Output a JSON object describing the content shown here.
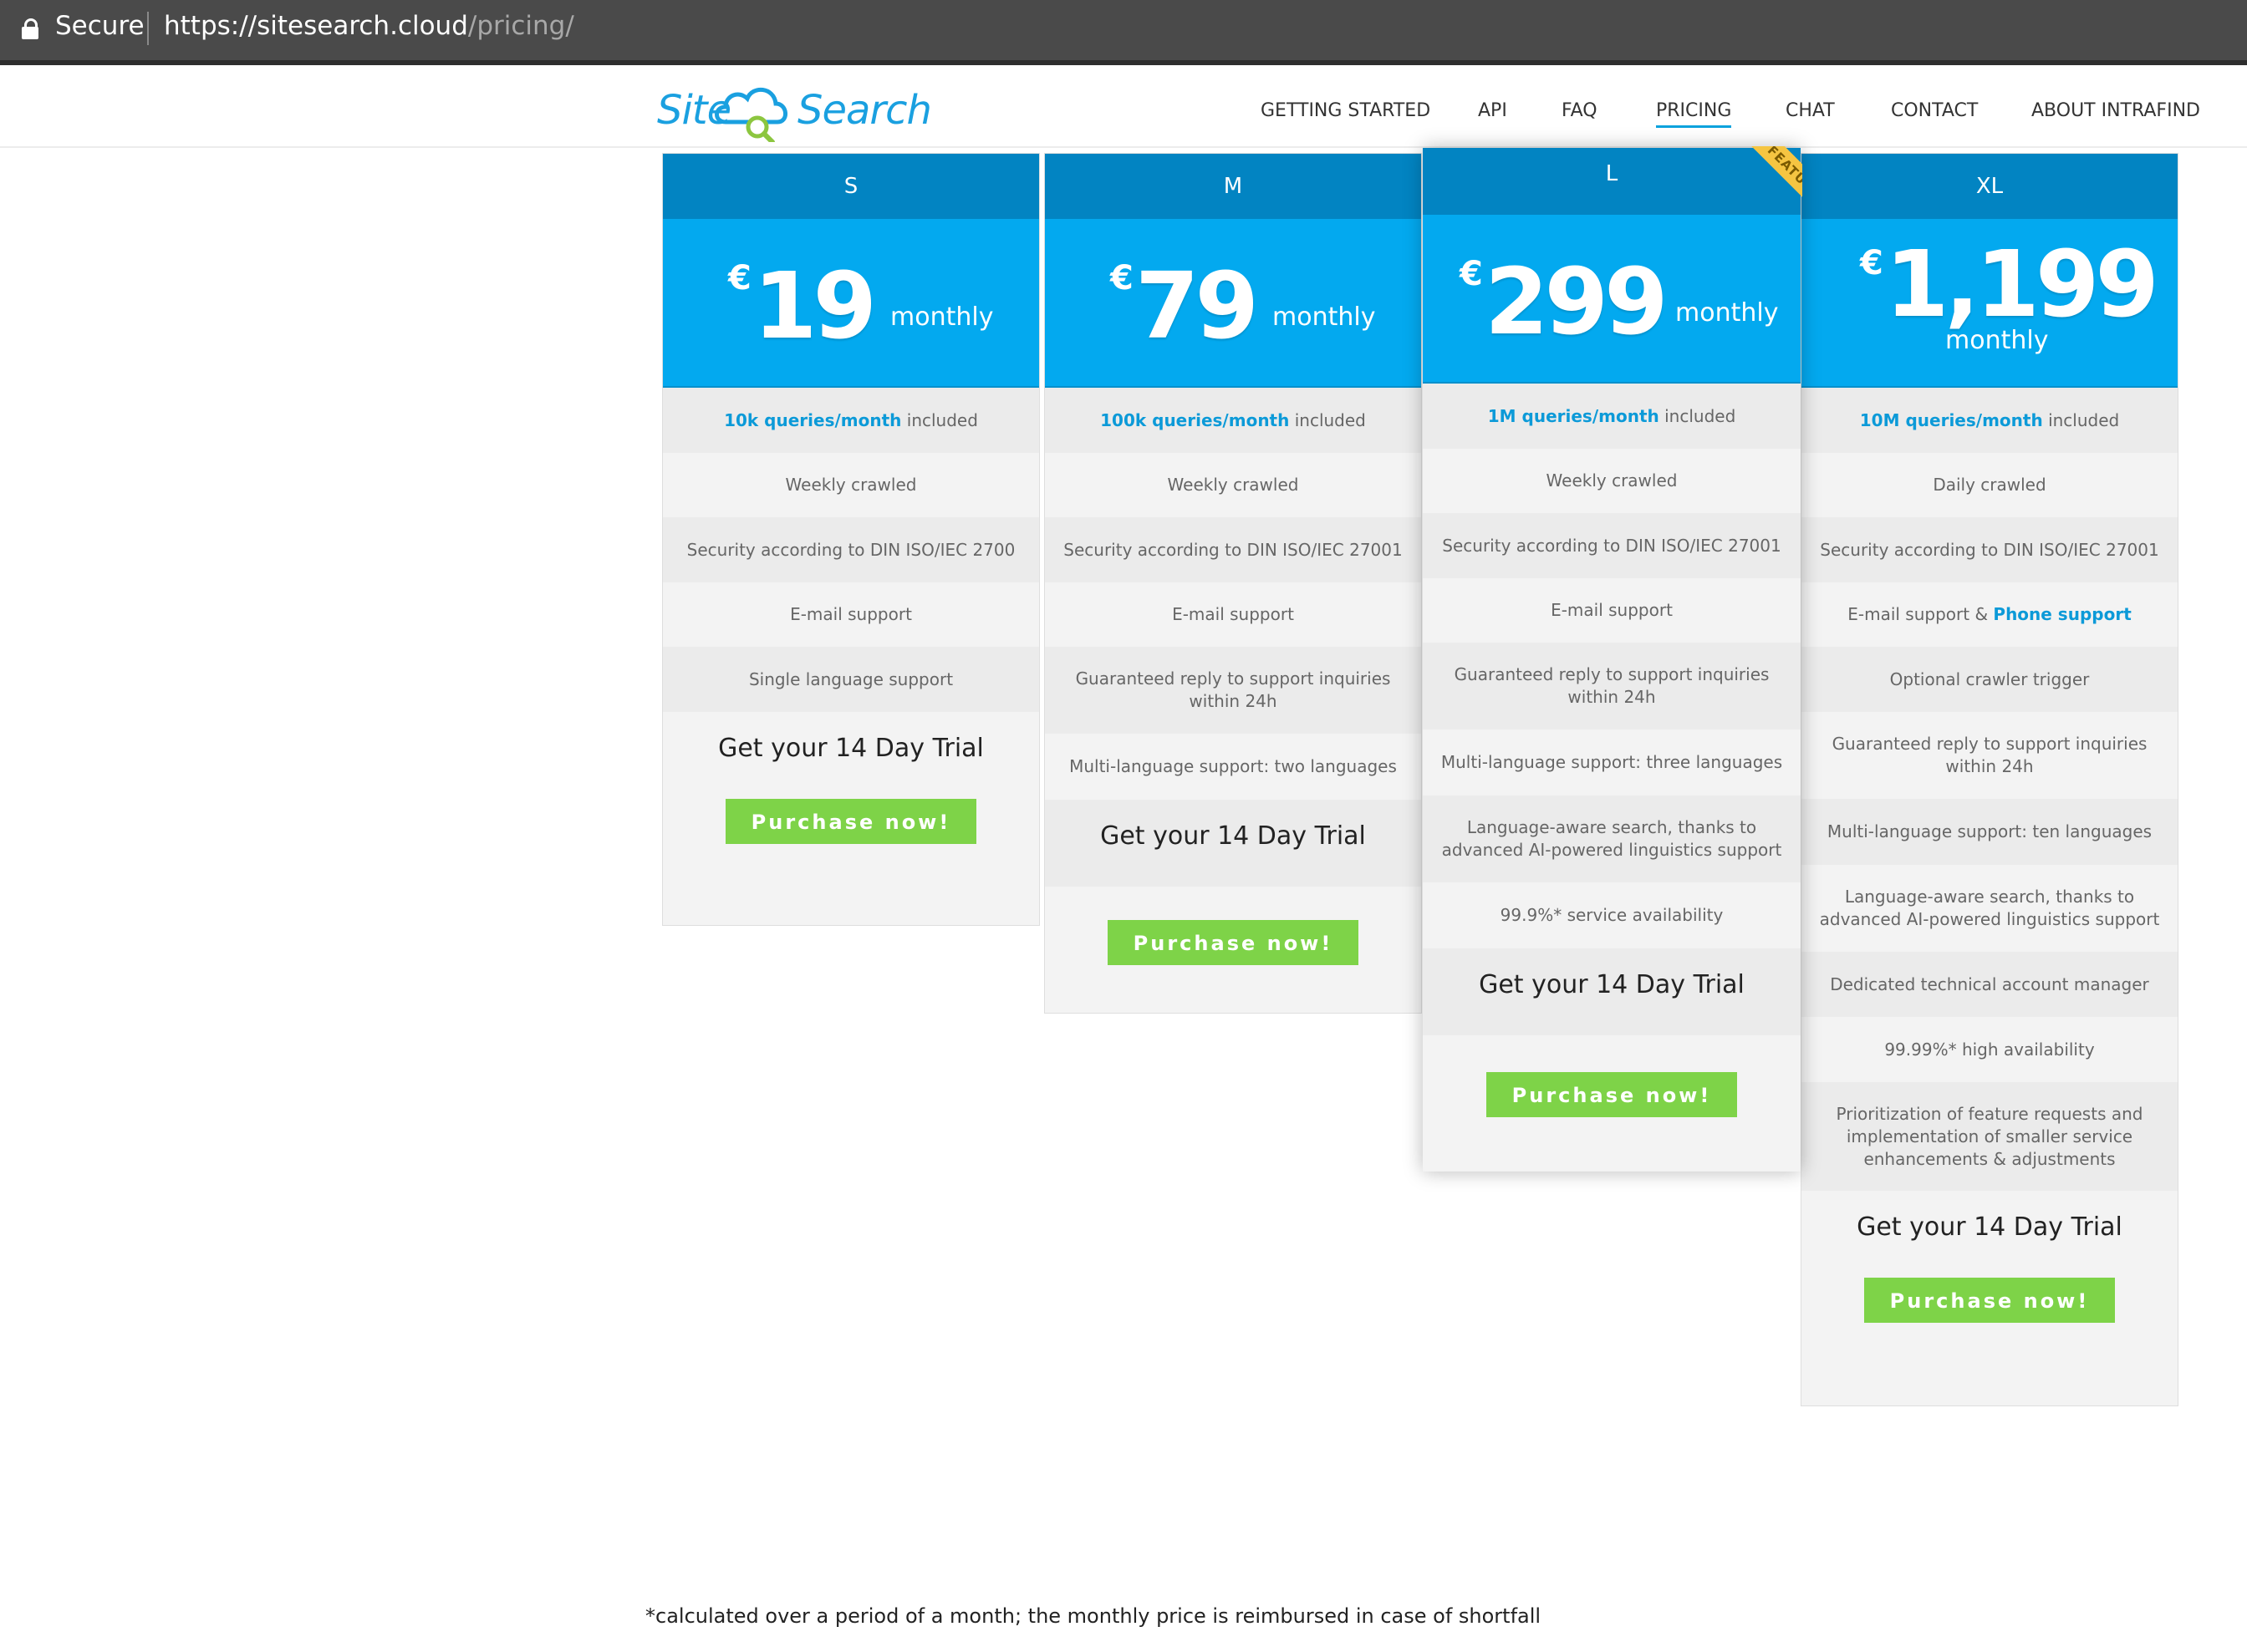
{
  "browser": {
    "secure_label": "Secure",
    "url_base": "https://sitesearch.cloud",
    "url_path": "/pricing/"
  },
  "logo": {
    "part1": "Site",
    "part2": "Search"
  },
  "nav": {
    "items": [
      "GETTING STARTED",
      "API",
      "FAQ",
      "PRICING",
      "CHAT",
      "CONTACT",
      "ABOUT INTRAFIND"
    ],
    "active": "PRICING"
  },
  "plans": [
    {
      "name": "S",
      "currency": "€",
      "price": "19",
      "period": "monthly",
      "queries": "10k queries/month",
      "queries_suffix": "included",
      "features": [
        "Weekly crawled",
        "Security according to DIN ISO/IEC 2700",
        "E-mail support",
        "Single language support"
      ],
      "trial": "Get your 14 Day Trial",
      "button": "Purchase now!"
    },
    {
      "name": "M",
      "currency": "€",
      "price": "79",
      "period": "monthly",
      "queries": "100k queries/month",
      "queries_suffix": "included",
      "features": [
        "Weekly crawled",
        "Security according to DIN ISO/IEC 27001",
        "E-mail support",
        "Guaranteed reply to support inquiries within 24h",
        "Multi-language support: two languages"
      ],
      "trial": "Get your 14 Day Trial",
      "button": "Purchase now!"
    },
    {
      "name": "L",
      "currency": "€",
      "price": "299",
      "period": "monthly",
      "ribbon": "FEATURED",
      "queries": "1M queries/month",
      "queries_suffix": "included",
      "features": [
        "Weekly crawled",
        "Security according to DIN ISO/IEC 27001",
        "E-mail support",
        "Guaranteed reply to support inquiries within 24h",
        "Multi-language support: three languages",
        "Language-aware search, thanks to advanced AI-powered linguistics support",
        "99.9%* service availability"
      ],
      "trial": "Get your 14 Day Trial",
      "button": "Purchase now!"
    },
    {
      "name": "XL",
      "currency": "€",
      "price": "1,199",
      "period": "monthly",
      "queries": "10M queries/month",
      "queries_suffix": "included",
      "features": [
        "Daily crawled",
        "Security according to DIN ISO/IEC 27001",
        "E-mail support & ",
        "Optional crawler trigger",
        "Guaranteed reply to support inquiries within 24h",
        "Multi-language support: ten languages",
        "Language-aware search, thanks to advanced AI-powered linguistics support",
        "Dedicated technical account manager",
        "99.99%* high availability",
        "Prioritization of feature requests and implementation of smaller service enhancements & adjustments"
      ],
      "phone_support": "Phone support",
      "trial": "Get your 14 Day Trial",
      "button": "Purchase now!"
    }
  ],
  "footnote": "*calculated over a period of a month; the monthly price is reimbursed in case of shortfall",
  "colors": {
    "header_dark": "#0284c2",
    "price_blue": "#03a9ef",
    "button_green": "#7ed348",
    "accent": "#0c9ad8"
  }
}
